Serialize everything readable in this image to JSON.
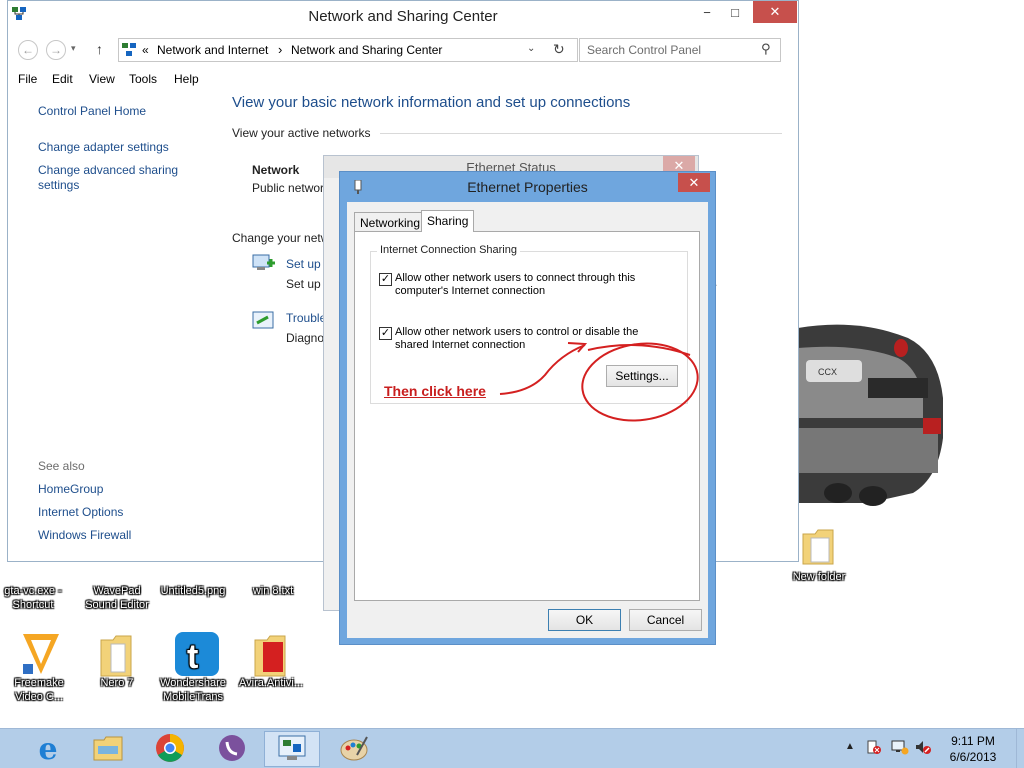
{
  "window": {
    "title": "Network and Sharing Center",
    "minimize": "−",
    "maximize": "□",
    "close": "✕"
  },
  "address_bar": {
    "chevrons": "«",
    "crumb1": "Network and Internet",
    "sep": "›",
    "crumb2": "Network and Sharing Center",
    "search_placeholder": "Search Control Panel"
  },
  "menu": [
    "File",
    "Edit",
    "View",
    "Tools",
    "Help"
  ],
  "left_pane": {
    "home": "Control Panel Home",
    "links": [
      "Change adapter settings",
      "Change advanced sharing settings"
    ],
    "see_also_label": "See also",
    "see_also": [
      "HomeGroup",
      "Internet Options",
      "Windows Firewall"
    ]
  },
  "main": {
    "title": "View your basic network information and set up connections",
    "active_networks": "View your active networks",
    "network_name": "Network",
    "network_type": "Public networ",
    "change_settings": "Change your netw",
    "setup_link": "Set up a",
    "setup_desc": "Set up a",
    "troubleshoot_link": "Trouble",
    "troubleshoot_desc": "Diagno",
    "trailing_dot": "."
  },
  "status_dialog": {
    "title": "Ethernet Status"
  },
  "properties_dialog": {
    "title": "Ethernet Properties",
    "tabs": [
      "Networking",
      "Sharing"
    ],
    "selected_tab": "Sharing",
    "group_label": "Internet Connection Sharing",
    "option1": "Allow other network users to connect through this computer's Internet connection",
    "option1_checked": true,
    "option2": "Allow other network users to control or disable the shared Internet connection",
    "option2_checked": true,
    "settings_button": "Settings...",
    "ok_button": "OK",
    "cancel_button": "Cancel"
  },
  "annotation": "Then click here",
  "desktop_icons": [
    {
      "label": "gta-vc.exe - Shortcut"
    },
    {
      "label": "WavePad Sound Editor"
    },
    {
      "label": "Untitled5.png"
    },
    {
      "label": "win 8.txt"
    },
    {
      "label": "New folder"
    },
    {
      "label": "Freemake Video C..."
    },
    {
      "label": "Nero 7"
    },
    {
      "label": "Wondershare MobileTrans"
    },
    {
      "label": "Avira.Antivi..."
    }
  ],
  "taskbar": {
    "time": "9:11 PM",
    "date": "6/6/2013"
  },
  "colors": {
    "link": "#1e4e8c",
    "close_red": "#c7504c",
    "dialog_frame": "#6fa6de",
    "taskbar": "#b3cde8",
    "annotation_red": "#c81e1e"
  }
}
